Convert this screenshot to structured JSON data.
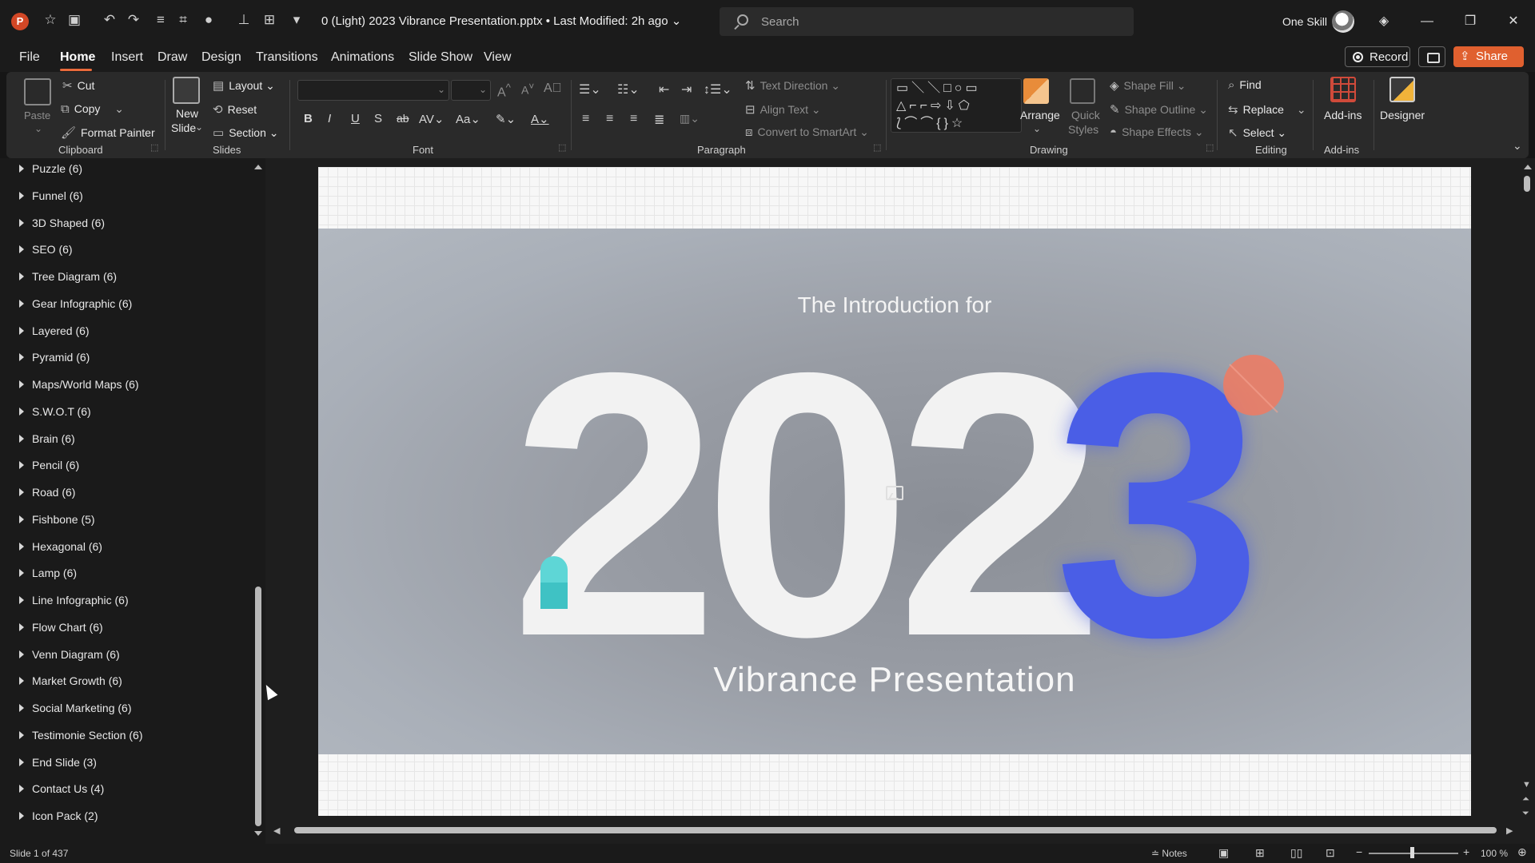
{
  "window": {
    "doc_title": "0 (Light) 2023 Vibrance Presentation.pptx • Last Modified: 2h ago",
    "search_placeholder": "Search",
    "user_name": "One Skill",
    "app_badge": "P"
  },
  "menu": {
    "tabs": [
      "File",
      "Home",
      "Insert",
      "Draw",
      "Design",
      "Transitions",
      "Animations",
      "Slide Show",
      "View"
    ],
    "active_tab": "Home",
    "record_label": "Record",
    "share_label": "Share"
  },
  "ribbon": {
    "clipboard": {
      "paste": "Paste",
      "cut": "Cut",
      "copy": "Copy",
      "format_painter": "Format Painter",
      "group": "Clipboard"
    },
    "slides": {
      "new_slide": "New Slide",
      "new_slide_l1": "New",
      "new_slide_l2": "Slide",
      "layout": "Layout",
      "reset": "Reset",
      "section": "Section",
      "group": "Slides"
    },
    "font": {
      "group": "Font"
    },
    "paragraph": {
      "text_direction": "Text Direction",
      "align_text": "Align Text",
      "convert_smartart": "Convert to SmartArt",
      "group": "Paragraph"
    },
    "drawing": {
      "arrange": "Arrange",
      "quick_styles_l1": "Quick",
      "quick_styles_l2": "Styles",
      "shape_fill": "Shape Fill",
      "shape_outline": "Shape Outline",
      "shape_effects": "Shape Effects",
      "group": "Drawing"
    },
    "editing": {
      "find": "Find",
      "replace": "Replace",
      "select": "Select",
      "group": "Editing"
    },
    "addins": {
      "addins": "Add-ins",
      "designer": "Designer",
      "group": "Add-ins"
    }
  },
  "sections": [
    "Puzzle (6)",
    "Funnel (6)",
    "3D Shaped (6)",
    "SEO (6)",
    "Tree Diagram (6)",
    "Gear Infographic (6)",
    "Layered (6)",
    "Pyramid (6)",
    "Maps/World Maps (6)",
    "S.W.O.T (6)",
    "Brain (6)",
    "Pencil (6)",
    "Road (6)",
    "Fishbone (5)",
    "Hexagonal (6)",
    "Lamp (6)",
    "Line Infographic (6)",
    "Flow Chart (6)",
    "Venn Diagram (6)",
    "Market Growth (6)",
    "Social Marketing (6)",
    "Testimonie Section (6)",
    "End Slide (3)",
    "Contact Us (4)",
    "Icon Pack (2)"
  ],
  "slide": {
    "subtitle": "The Introduction for",
    "year_prefix": "202",
    "year_last": "3",
    "title": "Vibrance Presentation",
    "colors": {
      "accent_blue": "#4a5ee6",
      "accent_coral": "#f07a62",
      "accent_teal": "#5ed6d6"
    }
  },
  "status": {
    "slide_count": "Slide 1 of 437",
    "notes": "Notes",
    "zoom": "100 %"
  }
}
